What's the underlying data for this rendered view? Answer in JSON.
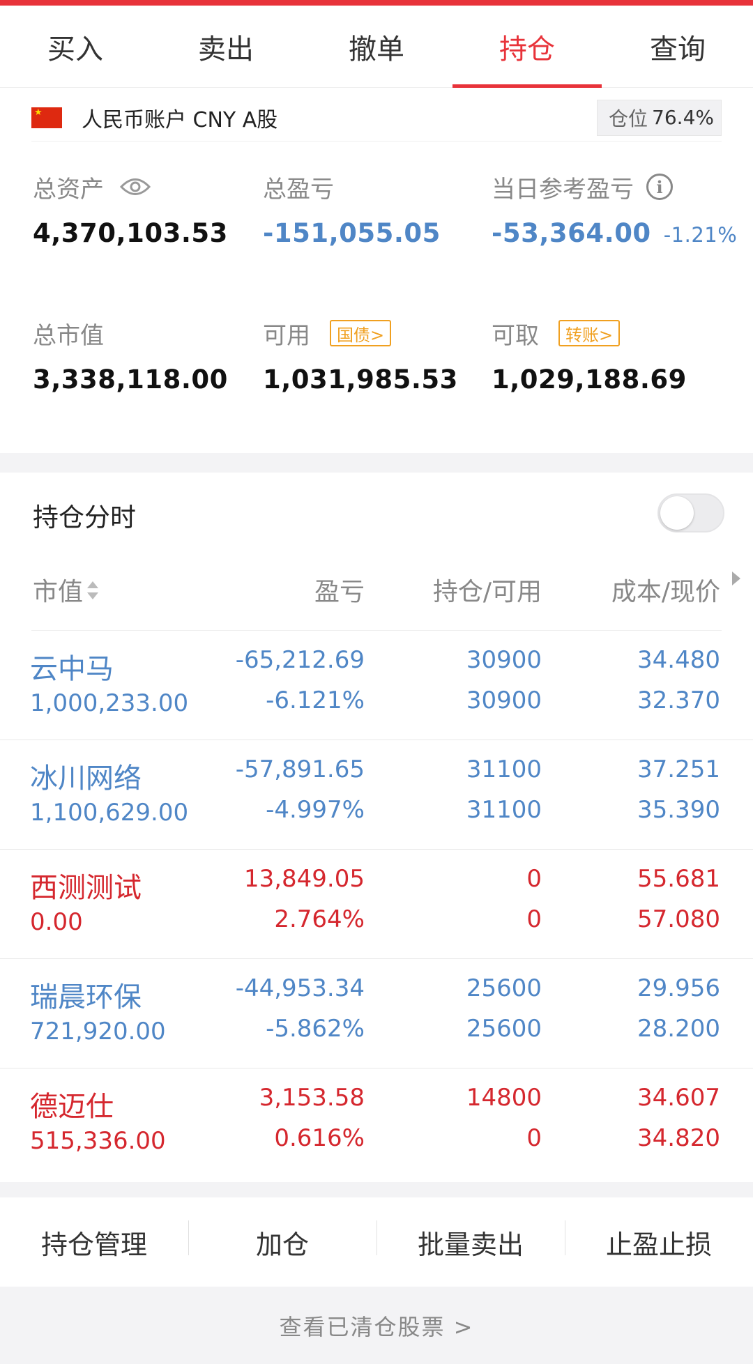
{
  "tabs": [
    {
      "label": "买入",
      "active": false
    },
    {
      "label": "卖出",
      "active": false
    },
    {
      "label": "撤单",
      "active": false
    },
    {
      "label": "持仓",
      "active": true
    },
    {
      "label": "查询",
      "active": false
    }
  ],
  "account": {
    "name": "人民币账户 CNY A股",
    "position_label": "仓位",
    "position_value": "76.4%"
  },
  "summary": {
    "total_assets_label": "总资产",
    "total_assets": "4,370,103.53",
    "total_pl_label": "总盈亏",
    "total_pl": "-151,055.05",
    "daily_pl_label": "当日参考盈亏",
    "daily_pl": "-53,364.00",
    "daily_pl_pct": "-1.21%",
    "market_value_label": "总市值",
    "market_value": "3,338,118.00",
    "available_label": "可用",
    "available_tag": "国债>",
    "available": "1,031,985.53",
    "withdrawable_label": "可取",
    "withdrawable_tag": "转账>",
    "withdrawable": "1,029,188.69"
  },
  "holdings": {
    "title": "持仓分时",
    "toggle_on": false,
    "headers": {
      "market_value": "市值",
      "pl": "盈亏",
      "qty": "持仓/可用",
      "price": "成本/现价"
    },
    "rows": [
      {
        "name": "云中马",
        "mv": "1,000,233.00",
        "pl": "-65,212.69",
        "pl_pct": "-6.121%",
        "qty": "30900",
        "avail": "30900",
        "cost": "34.480",
        "price": "32.370",
        "dir": "down"
      },
      {
        "name": "冰川网络",
        "mv": "1,100,629.00",
        "pl": "-57,891.65",
        "pl_pct": "-4.997%",
        "qty": "31100",
        "avail": "31100",
        "cost": "37.251",
        "price": "35.390",
        "dir": "down"
      },
      {
        "name": "西测测试",
        "mv": "0.00",
        "pl": "13,849.05",
        "pl_pct": "2.764%",
        "qty": "0",
        "avail": "0",
        "cost": "55.681",
        "price": "57.080",
        "dir": "up"
      },
      {
        "name": "瑞晨环保",
        "mv": "721,920.00",
        "pl": "-44,953.34",
        "pl_pct": "-5.862%",
        "qty": "25600",
        "avail": "25600",
        "cost": "29.956",
        "price": "28.200",
        "dir": "down"
      },
      {
        "name": "德迈仕",
        "mv": "515,336.00",
        "pl": "3,153.58",
        "pl_pct": "0.616%",
        "qty": "14800",
        "avail": "0",
        "cost": "34.607",
        "price": "34.820",
        "dir": "up"
      }
    ]
  },
  "actions": [
    "持仓管理",
    "加仓",
    "批量卖出",
    "止盈止损"
  ],
  "footer": "查看已清仓股票 >",
  "colors": {
    "accent": "#e8333a",
    "down": "#4f86c6",
    "up": "#d5272e",
    "tag": "#f0a020"
  }
}
